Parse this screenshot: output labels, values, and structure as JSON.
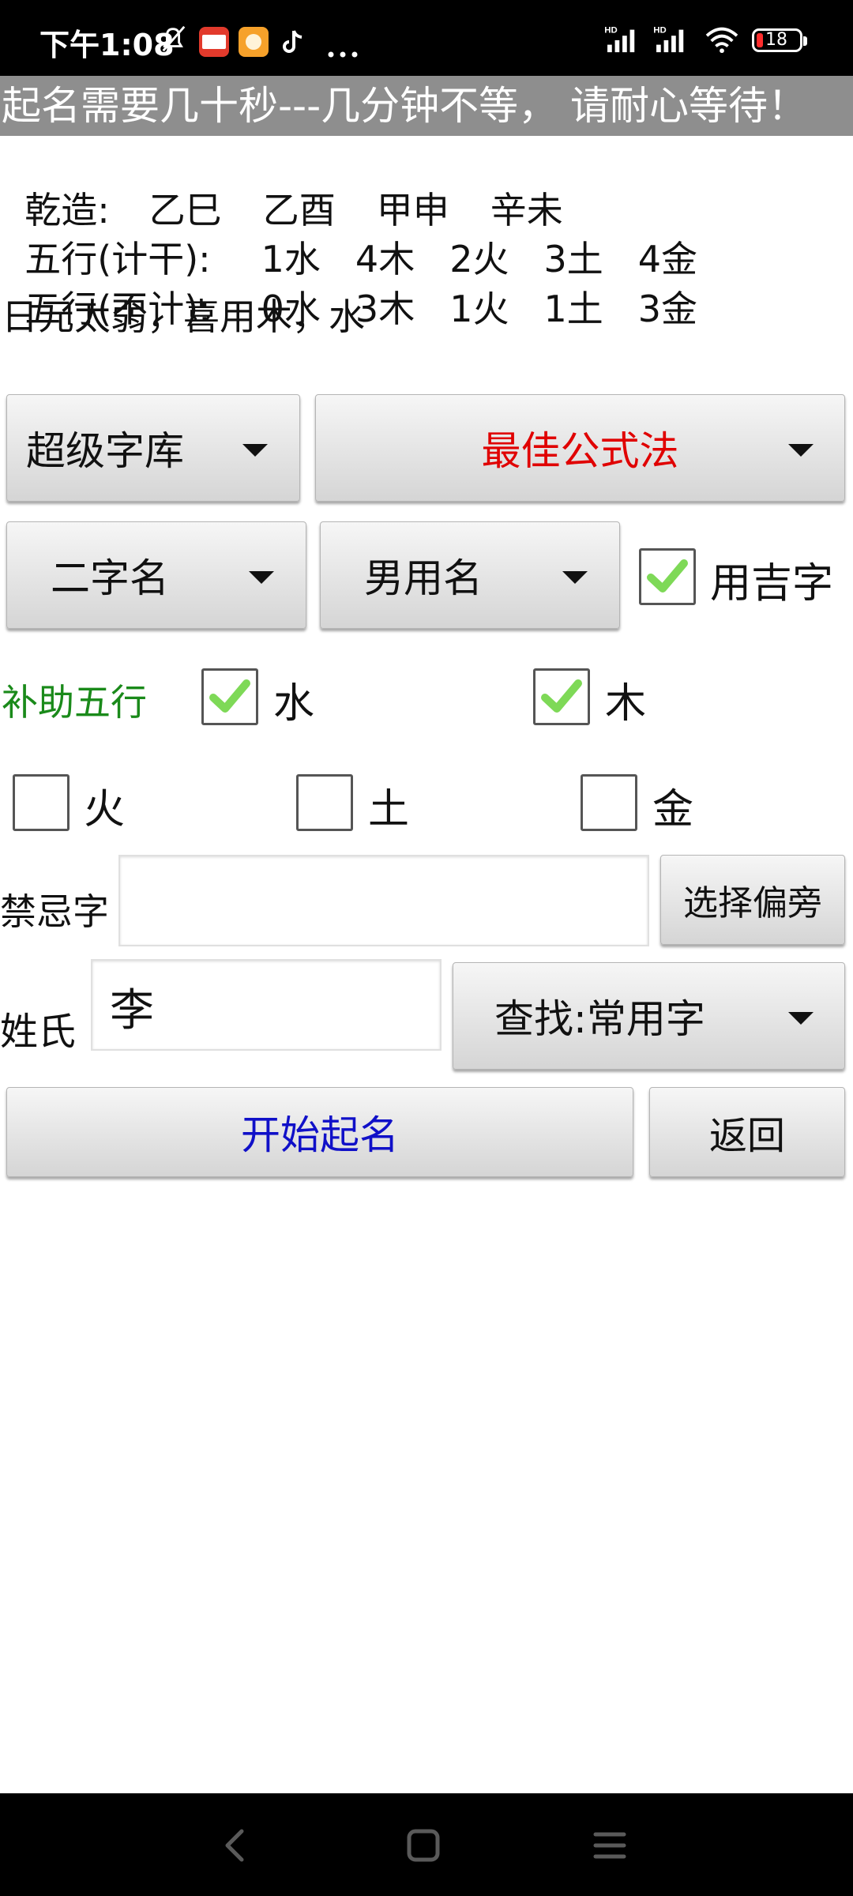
{
  "status_bar": {
    "time": "下午1:08",
    "battery": "18",
    "icons": [
      "bell-off-icon",
      "toutiao-app-icon",
      "game-app-icon",
      "tiktok-icon",
      "more-dots-icon",
      "hd-signal-icon",
      "hd-signal-icon-2",
      "wifi-icon",
      "battery-icon"
    ]
  },
  "notice": "起名需要几十秒---几分钟不等， 请耐心等待！",
  "info": {
    "bazi_label": "乾造:",
    "bazi": [
      "乙巳",
      "乙酉",
      "甲申",
      "辛未"
    ],
    "wuxing_with_label": "五行(计干):",
    "wuxing_with": [
      "1水",
      "4木",
      "2火",
      "3土",
      "4金"
    ],
    "wuxing_without_label": "五行(不计):",
    "wuxing_without": [
      "0水",
      "3木",
      "1火",
      "1土",
      "3金"
    ],
    "summary": "日元太弱，喜用木，水"
  },
  "controls": {
    "library": "超级字库",
    "method": "最佳公式法",
    "name_length": "二字名",
    "gender": "男用名",
    "use_lucky_chars": {
      "label": "用吉字",
      "checked": true
    }
  },
  "wuxing_support": {
    "label": "补助五行",
    "options": [
      {
        "label": "水",
        "checked": true
      },
      {
        "label": "木",
        "checked": true
      },
      {
        "label": "火",
        "checked": false
      },
      {
        "label": "土",
        "checked": false
      },
      {
        "label": "金",
        "checked": false
      }
    ]
  },
  "forbidden": {
    "label": "禁忌字",
    "value": "",
    "button": "选择偏旁"
  },
  "surname": {
    "label": "姓氏",
    "value": "李",
    "search": "查找:常用字"
  },
  "actions": {
    "start": "开始起名",
    "back": "返回"
  },
  "colors": {
    "method_text": "#e00000",
    "start_text": "#1010c8",
    "support_label": "#1a8a1a",
    "check": "#7ed957"
  }
}
